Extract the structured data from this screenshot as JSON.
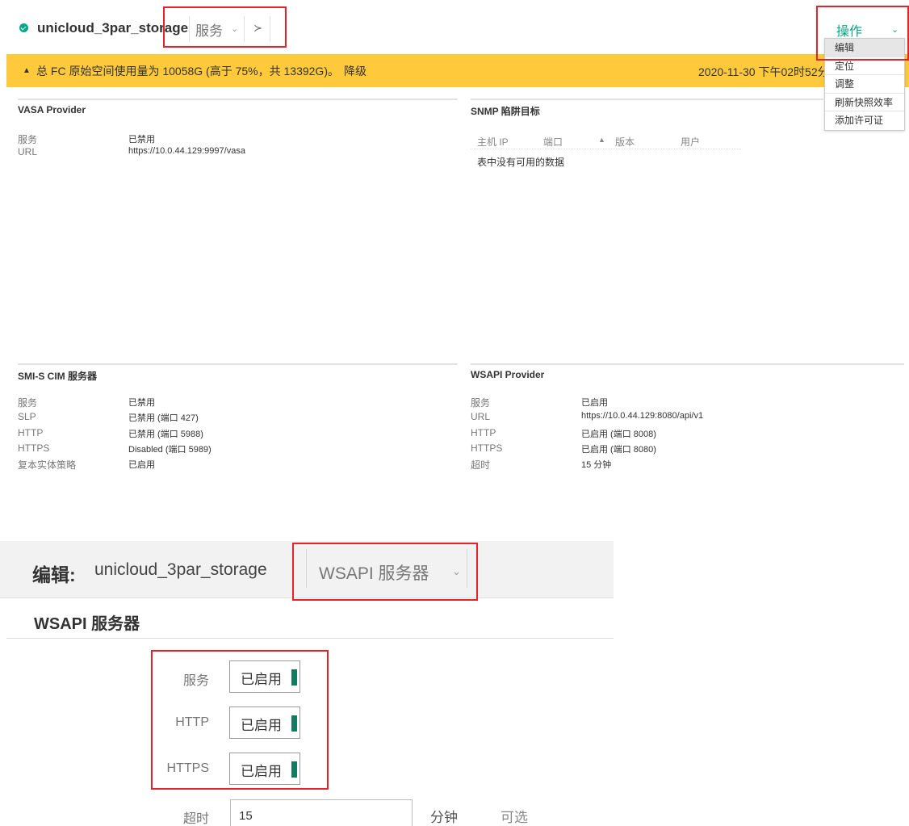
{
  "header": {
    "title": "unicloud_3par_storage",
    "view_select": "服务",
    "actions_label": "操作"
  },
  "alert": {
    "message": "总 FC 原始空间使用量为 10058G (高于 75%，共 13392G)。",
    "link": "降级",
    "timestamp": "2020-11-30 下午02时52分"
  },
  "actions_menu": {
    "items": [
      "编辑",
      "定位",
      "调整",
      "刷新快照效率",
      "添加许可证"
    ]
  },
  "vasa": {
    "title": "VASA Provider",
    "rows": [
      {
        "label": "服务",
        "value": "已禁用"
      },
      {
        "label": "URL",
        "value": "https://10.0.44.129:9997/vasa"
      }
    ]
  },
  "snmp": {
    "title": "SNMP 陷阱目标",
    "columns": [
      "主机 IP",
      "端口",
      "版本",
      "用户"
    ],
    "empty_message": "表中没有可用的数据"
  },
  "smis": {
    "title": "SMI-S CIM 服务器",
    "rows": [
      {
        "label": "服务",
        "value": "已禁用"
      },
      {
        "label": "SLP",
        "value": "已禁用 (端口 427)"
      },
      {
        "label": "HTTP",
        "value": "已禁用 (端口 5988)"
      },
      {
        "label": "HTTPS",
        "value": "Disabled (端口 5989)"
      },
      {
        "label": "复本实体策略",
        "value": "已启用"
      }
    ]
  },
  "wsapi": {
    "title": "WSAPI Provider",
    "rows": [
      {
        "label": "服务",
        "value": "已启用"
      },
      {
        "label": "URL",
        "value": "https://10.0.44.129:8080/api/v1"
      },
      {
        "label": "HTTP",
        "value": "已启用 (端口 8008)"
      },
      {
        "label": "HTTPS",
        "value": "已启用 (端口 8080)"
      },
      {
        "label": "超时",
        "value": "15 分钟"
      }
    ]
  },
  "edit": {
    "title_prefix": "编辑:",
    "title_name": "unicloud_3par_storage",
    "view_select": "WSAPI 服务器",
    "section_heading": "WSAPI 服务器",
    "fields": [
      {
        "label": "服务",
        "value": "已启用"
      },
      {
        "label": "HTTP",
        "value": "已启用"
      },
      {
        "label": "HTTPS",
        "value": "已启用"
      }
    ],
    "timeout": {
      "label": "超时",
      "value": "15",
      "unit": "分钟",
      "hint": "可选"
    }
  },
  "colors": {
    "accent": "#01a982",
    "warning": "#fec93a",
    "highlight": "#e8222b",
    "toggle_on": "#127d5e"
  },
  "icons": {
    "status": "check-circle-icon",
    "view_chevron": "chevron-down-icon",
    "alert": "warning-triangle-icon",
    "sort": "sort-ascending-icon"
  }
}
